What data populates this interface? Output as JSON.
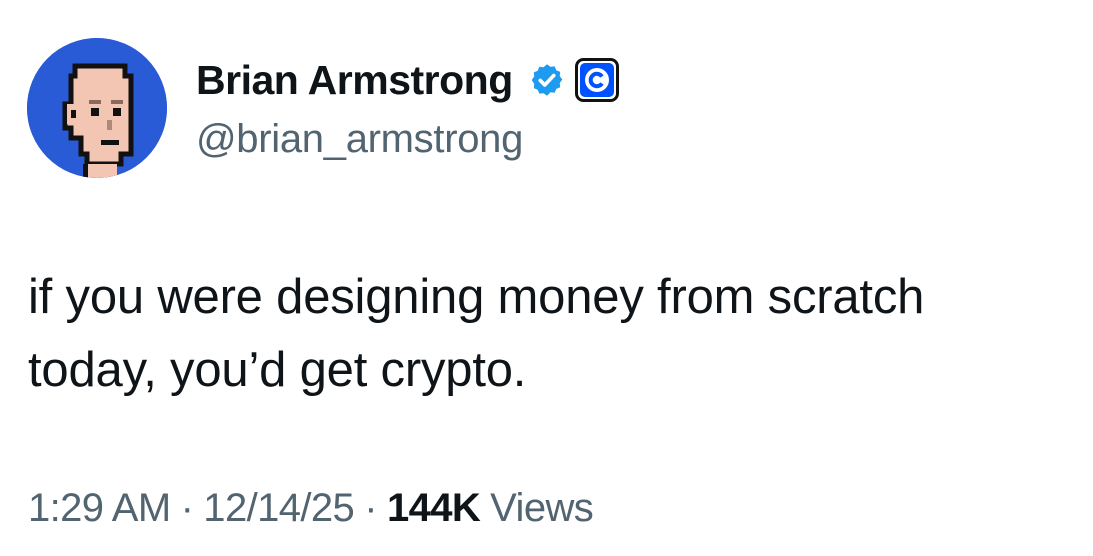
{
  "author": {
    "display_name": "Brian Armstrong",
    "handle": "@brian_armstrong",
    "avatar_icon": "pixel-punk-avatar",
    "verified_icon": "verified-badge-icon",
    "affiliate_icon": "coinbase-affiliate-icon"
  },
  "tweet": {
    "text": "if you were designing money from scratch\ntoday, you’d get crypto."
  },
  "meta": {
    "time": "1:29 AM",
    "separator": "·",
    "date": "12/14/25",
    "views_count": "144K",
    "views_label": "Views"
  },
  "colors": {
    "text_primary": "#0f1419",
    "text_secondary": "#536471",
    "verified_blue": "#1d9bf0",
    "avatar_background": "#2a5bd7",
    "coinbase_blue": "#0052ff"
  }
}
